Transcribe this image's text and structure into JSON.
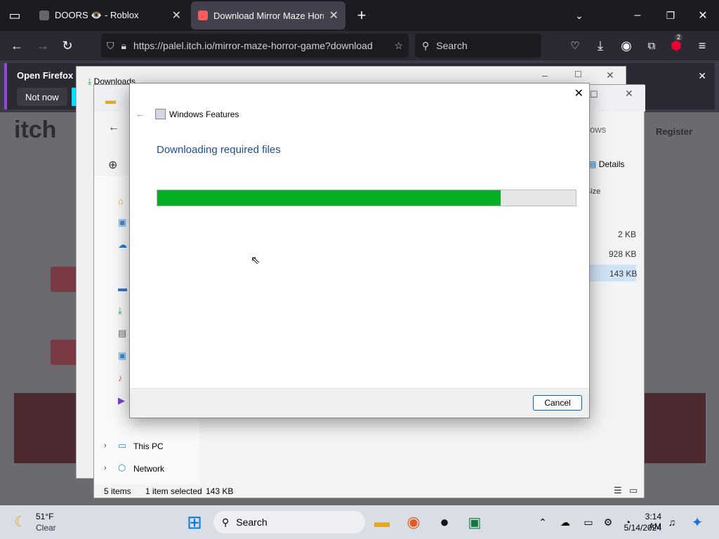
{
  "browser": {
    "tabs": [
      {
        "title": "DOORS 👁️ - Roblox"
      },
      {
        "title": "Download Mirror Maze Horror"
      }
    ],
    "url": "https://palel.itch.io/mirror-maze-horror-game?download",
    "search_placeholder": "Search",
    "notification": {
      "text": "Open Firefox ev",
      "not_now": "Not now"
    },
    "ext_badge": "2"
  },
  "itch": {
    "register": "Register",
    "logo_text": "itch"
  },
  "downloads_window": {
    "title": "Downloads"
  },
  "explorer": {
    "view_label": "ows",
    "details": "Details",
    "col_size": "Size",
    "sizes": [
      "2 KB",
      "928 KB",
      "143 KB"
    ],
    "nav": [
      {
        "label": "This PC"
      },
      {
        "label": "Network"
      }
    ],
    "status": {
      "items": "5 items",
      "selected": "1 item selected",
      "size": "143 KB"
    }
  },
  "dialog": {
    "title": "Windows Features",
    "heading": "Downloading required files",
    "progress": 0.82,
    "cancel": "Cancel"
  },
  "taskbar": {
    "weather_temp": "51°F",
    "weather_desc": "Clear",
    "search": "Search",
    "time": "3:14 AM",
    "date": "5/14/2024"
  },
  "colors": {
    "progress": "#06b025",
    "accent": "#1f4e8c",
    "firefox_dark": "#1c1b22"
  }
}
